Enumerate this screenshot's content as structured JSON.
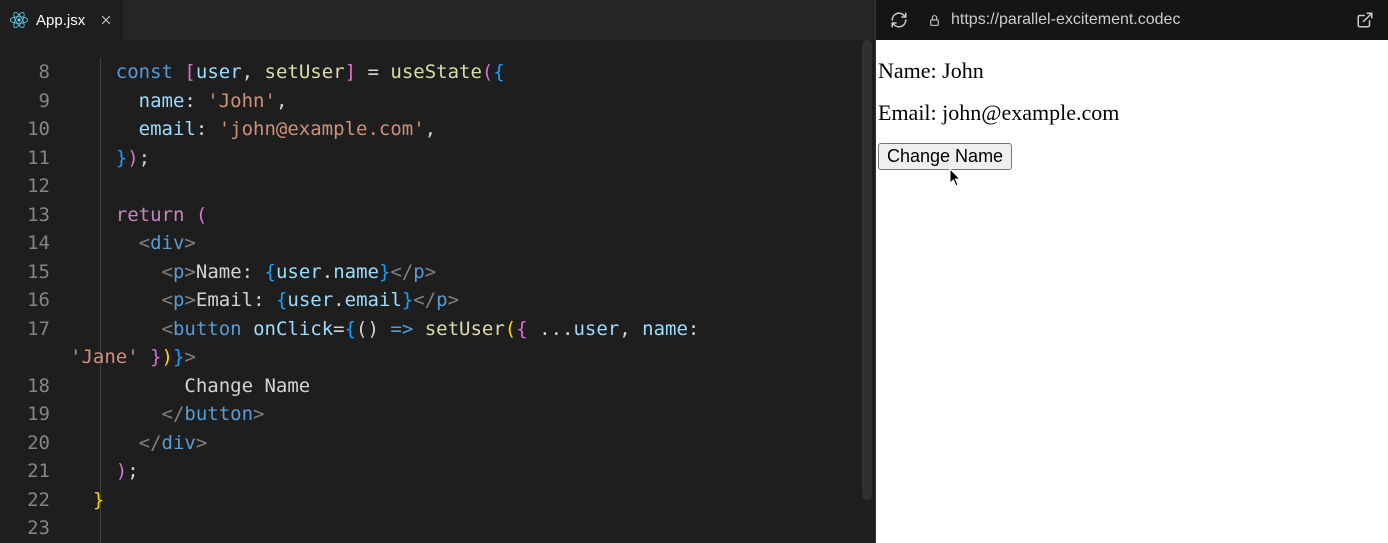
{
  "editor": {
    "tab": {
      "filename": "App.jsx",
      "icon": "react-icon"
    },
    "line_start": 8,
    "gutter": [
      "8",
      "9",
      "10",
      "11",
      "12",
      "13",
      "14",
      "15",
      "16",
      "17",
      "",
      "18",
      "19",
      "20",
      "21",
      "22",
      "23"
    ],
    "code_lines": [
      [
        [
          "    ",
          ""
        ],
        [
          "const",
          "tok-id"
        ],
        [
          " ",
          ""
        ],
        [
          "[",
          "tok-pun3"
        ],
        [
          "user",
          "tok-var"
        ],
        [
          ", ",
          "tok-punc"
        ],
        [
          "setUser",
          "tok-fn"
        ],
        [
          "]",
          "tok-pun3"
        ],
        [
          " = ",
          "tok-punc"
        ],
        [
          "useState",
          "tok-fn"
        ],
        [
          "(",
          "tok-pun3"
        ],
        [
          "{",
          "tok-pun4"
        ]
      ],
      [
        [
          "      ",
          ""
        ],
        [
          "name",
          "tok-var"
        ],
        [
          ": ",
          "tok-punc"
        ],
        [
          "'John'",
          "tok-str"
        ],
        [
          ",",
          "tok-punc"
        ]
      ],
      [
        [
          "      ",
          ""
        ],
        [
          "email",
          "tok-var"
        ],
        [
          ": ",
          "tok-punc"
        ],
        [
          "'john@example.com'",
          "tok-str"
        ],
        [
          ",",
          "tok-punc"
        ]
      ],
      [
        [
          "    ",
          ""
        ],
        [
          "}",
          "tok-pun4"
        ],
        [
          ")",
          "tok-pun3"
        ],
        [
          ";",
          "tok-punc"
        ]
      ],
      [
        [
          "",
          ""
        ]
      ],
      [
        [
          "    ",
          ""
        ],
        [
          "return",
          "tok-kw"
        ],
        [
          " ",
          ""
        ],
        [
          "(",
          "tok-pun3"
        ]
      ],
      [
        [
          "      ",
          ""
        ],
        [
          "<",
          "tok-tagb"
        ],
        [
          "div",
          "tok-tag"
        ],
        [
          ">",
          "tok-tagb"
        ]
      ],
      [
        [
          "        ",
          ""
        ],
        [
          "<",
          "tok-tagb"
        ],
        [
          "p",
          "tok-tag"
        ],
        [
          ">",
          "tok-tagb"
        ],
        [
          "Name: ",
          "tok-text"
        ],
        [
          "{",
          "tok-pun4"
        ],
        [
          "user",
          "tok-var"
        ],
        [
          ".",
          "tok-punc"
        ],
        [
          "name",
          "tok-var"
        ],
        [
          "}",
          "tok-pun4"
        ],
        [
          "</",
          "tok-tagb"
        ],
        [
          "p",
          "tok-tag"
        ],
        [
          ">",
          "tok-tagb"
        ]
      ],
      [
        [
          "        ",
          ""
        ],
        [
          "<",
          "tok-tagb"
        ],
        [
          "p",
          "tok-tag"
        ],
        [
          ">",
          "tok-tagb"
        ],
        [
          "Email: ",
          "tok-text"
        ],
        [
          "{",
          "tok-pun4"
        ],
        [
          "user",
          "tok-var"
        ],
        [
          ".",
          "tok-punc"
        ],
        [
          "email",
          "tok-var"
        ],
        [
          "}",
          "tok-pun4"
        ],
        [
          "</",
          "tok-tagb"
        ],
        [
          "p",
          "tok-tag"
        ],
        [
          ">",
          "tok-tagb"
        ]
      ],
      [
        [
          "        ",
          ""
        ],
        [
          "<",
          "tok-tagb"
        ],
        [
          "button",
          "tok-tag"
        ],
        [
          " ",
          ""
        ],
        [
          "onClick",
          "tok-attr"
        ],
        [
          "=",
          "tok-punc"
        ],
        [
          "{",
          "tok-pun4"
        ],
        [
          "() ",
          "tok-punc"
        ],
        [
          "=>",
          "tok-id"
        ],
        [
          " ",
          ""
        ],
        [
          "setUser",
          "tok-fn"
        ],
        [
          "(",
          "tok-pun2"
        ],
        [
          "{ ",
          "tok-pun3"
        ],
        [
          "...",
          "tok-punc"
        ],
        [
          "user",
          "tok-var"
        ],
        [
          ", ",
          "tok-punc"
        ],
        [
          "name",
          "tok-var"
        ],
        [
          ": ",
          "tok-punc"
        ]
      ],
      [
        [
          "'Jane'",
          "tok-str"
        ],
        [
          " ",
          ""
        ],
        [
          "}",
          "tok-pun3"
        ],
        [
          ")",
          "tok-pun2"
        ],
        [
          "}",
          "tok-pun4"
        ],
        [
          ">",
          "tok-tagb"
        ]
      ],
      [
        [
          "          ",
          ""
        ],
        [
          "Change Name",
          "tok-text"
        ]
      ],
      [
        [
          "        ",
          ""
        ],
        [
          "</",
          "tok-tagb"
        ],
        [
          "button",
          "tok-tag"
        ],
        [
          ">",
          "tok-tagb"
        ]
      ],
      [
        [
          "      ",
          ""
        ],
        [
          "</",
          "tok-tagb"
        ],
        [
          "div",
          "tok-tag"
        ],
        [
          ">",
          "tok-tagb"
        ]
      ],
      [
        [
          "    ",
          ""
        ],
        [
          ")",
          "tok-pun3"
        ],
        [
          ";",
          "tok-punc"
        ]
      ],
      [
        [
          "  ",
          ""
        ],
        [
          "}",
          "tok-pun2"
        ]
      ],
      [
        [
          "",
          ""
        ]
      ]
    ]
  },
  "preview": {
    "url": "https://parallel-excitement.codec",
    "output": {
      "name_label": "Name: ",
      "name_value": "John",
      "email_label": "Email: ",
      "email_value": "john@example.com",
      "button_label": "Change Name"
    }
  }
}
